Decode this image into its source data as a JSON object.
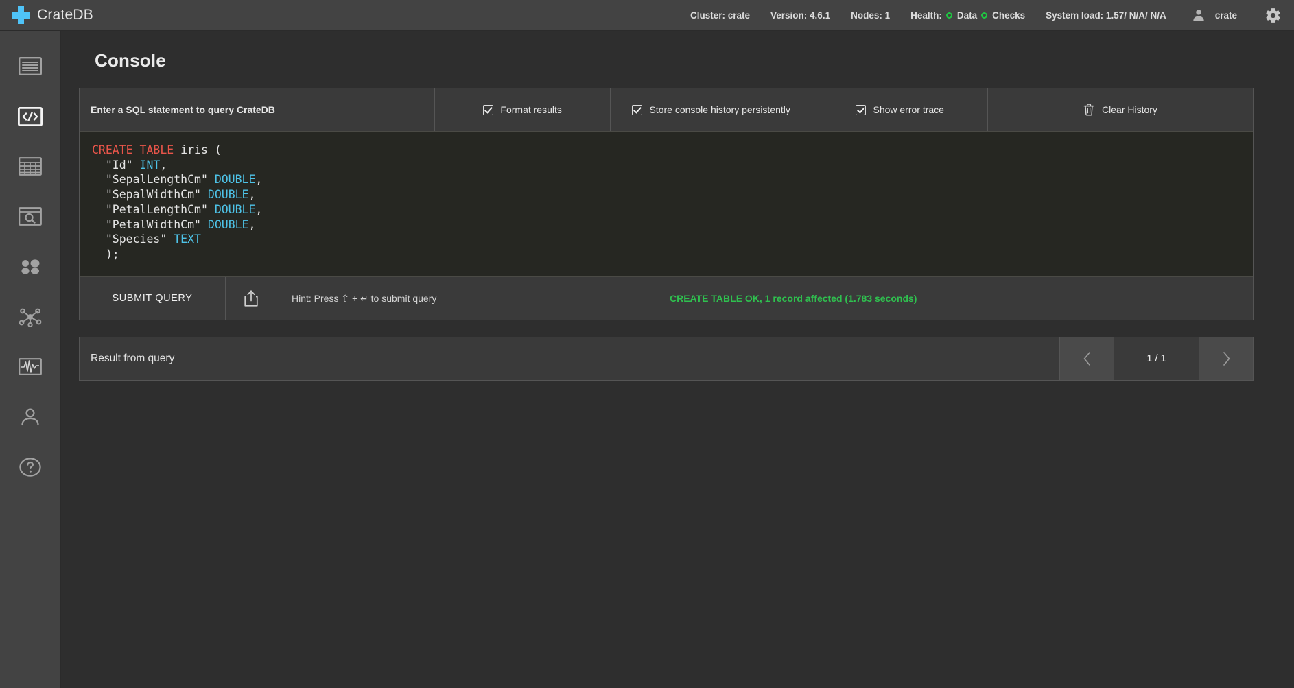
{
  "app": {
    "brand": "CrateDB",
    "logo_color": "#4fc3f7"
  },
  "topnav": {
    "stats": [
      {
        "label": "Cluster: crate"
      },
      {
        "label": "Version: 4.6.1"
      },
      {
        "label": "Nodes: 1"
      }
    ],
    "health": {
      "label": "Health:",
      "indicators": [
        {
          "label": "Data",
          "color": "#1fc742"
        },
        {
          "label": "Checks",
          "color": "#1fc742"
        }
      ]
    },
    "system_load": "System load: 1.57/ N/A/ N/A",
    "user": "crate",
    "settings_icon": "gear-icon"
  },
  "sidebar": {
    "items": [
      {
        "icon": "overview-icon",
        "name": "overview",
        "active": false
      },
      {
        "icon": "console-icon",
        "name": "console",
        "active": true
      },
      {
        "icon": "tables-icon",
        "name": "tables",
        "active": false
      },
      {
        "icon": "search-icon",
        "name": "search",
        "active": false
      },
      {
        "icon": "shards-icon",
        "name": "shards",
        "active": false
      },
      {
        "icon": "cluster-icon",
        "name": "cluster",
        "active": false
      },
      {
        "icon": "monitoring-icon",
        "name": "monitoring",
        "active": false
      },
      {
        "icon": "user-icon",
        "name": "users",
        "active": false
      },
      {
        "icon": "help-icon",
        "name": "help",
        "active": false
      }
    ]
  },
  "main": {
    "page_title": "Console",
    "toolbar": {
      "prompt": "Enter a SQL statement to query CrateDB",
      "options": [
        {
          "label": "Format results",
          "checked": true
        },
        {
          "label": "Store console history persistently",
          "checked": true
        },
        {
          "label": "Show error trace",
          "checked": true
        }
      ],
      "clear_history": "Clear History",
      "clear_history_icon": "trash-icon"
    },
    "editor": {
      "lines": [
        {
          "tokens": [
            {
              "t": "CREATE",
              "c": "kw"
            },
            {
              "t": " ",
              "c": ""
            },
            {
              "t": "TABLE",
              "c": "kw"
            },
            {
              "t": " iris (",
              "c": ""
            }
          ]
        },
        {
          "tokens": [
            {
              "t": "  \"Id\" ",
              "c": ""
            },
            {
              "t": "INT",
              "c": "type"
            },
            {
              "t": ",",
              "c": ""
            }
          ]
        },
        {
          "tokens": [
            {
              "t": "  \"SepalLengthCm\" ",
              "c": ""
            },
            {
              "t": "DOUBLE",
              "c": "type"
            },
            {
              "t": ",",
              "c": ""
            }
          ]
        },
        {
          "tokens": [
            {
              "t": "  \"SepalWidthCm\" ",
              "c": ""
            },
            {
              "t": "DOUBLE",
              "c": "type"
            },
            {
              "t": ",",
              "c": ""
            }
          ]
        },
        {
          "tokens": [
            {
              "t": "  \"PetalLengthCm\" ",
              "c": ""
            },
            {
              "t": "DOUBLE",
              "c": "type"
            },
            {
              "t": ",",
              "c": ""
            }
          ]
        },
        {
          "tokens": [
            {
              "t": "  \"PetalWidthCm\" ",
              "c": ""
            },
            {
              "t": "DOUBLE",
              "c": "type"
            },
            {
              "t": ",",
              "c": ""
            }
          ]
        },
        {
          "tokens": [
            {
              "t": "  \"Species\" ",
              "c": ""
            },
            {
              "t": "TEXT",
              "c": "type"
            }
          ]
        },
        {
          "tokens": [
            {
              "t": "  );",
              "c": ""
            }
          ]
        }
      ],
      "keyword_color": "#e8554a",
      "type_color": "#4ec3e8",
      "background": "#262722"
    },
    "actions": {
      "submit_label": "SUBMIT QUERY",
      "export_icon": "export-icon",
      "hint": "Hint: Press ⇧ + ↵ to submit query",
      "status": "CREATE TABLE OK, 1 record affected (1.783 seconds)",
      "status_color": "#2fc04f"
    },
    "result": {
      "label": "Result from query",
      "prev_icon": "chevron-left-icon",
      "next_icon": "chevron-right-icon",
      "page_indicator": "1 / 1"
    }
  }
}
